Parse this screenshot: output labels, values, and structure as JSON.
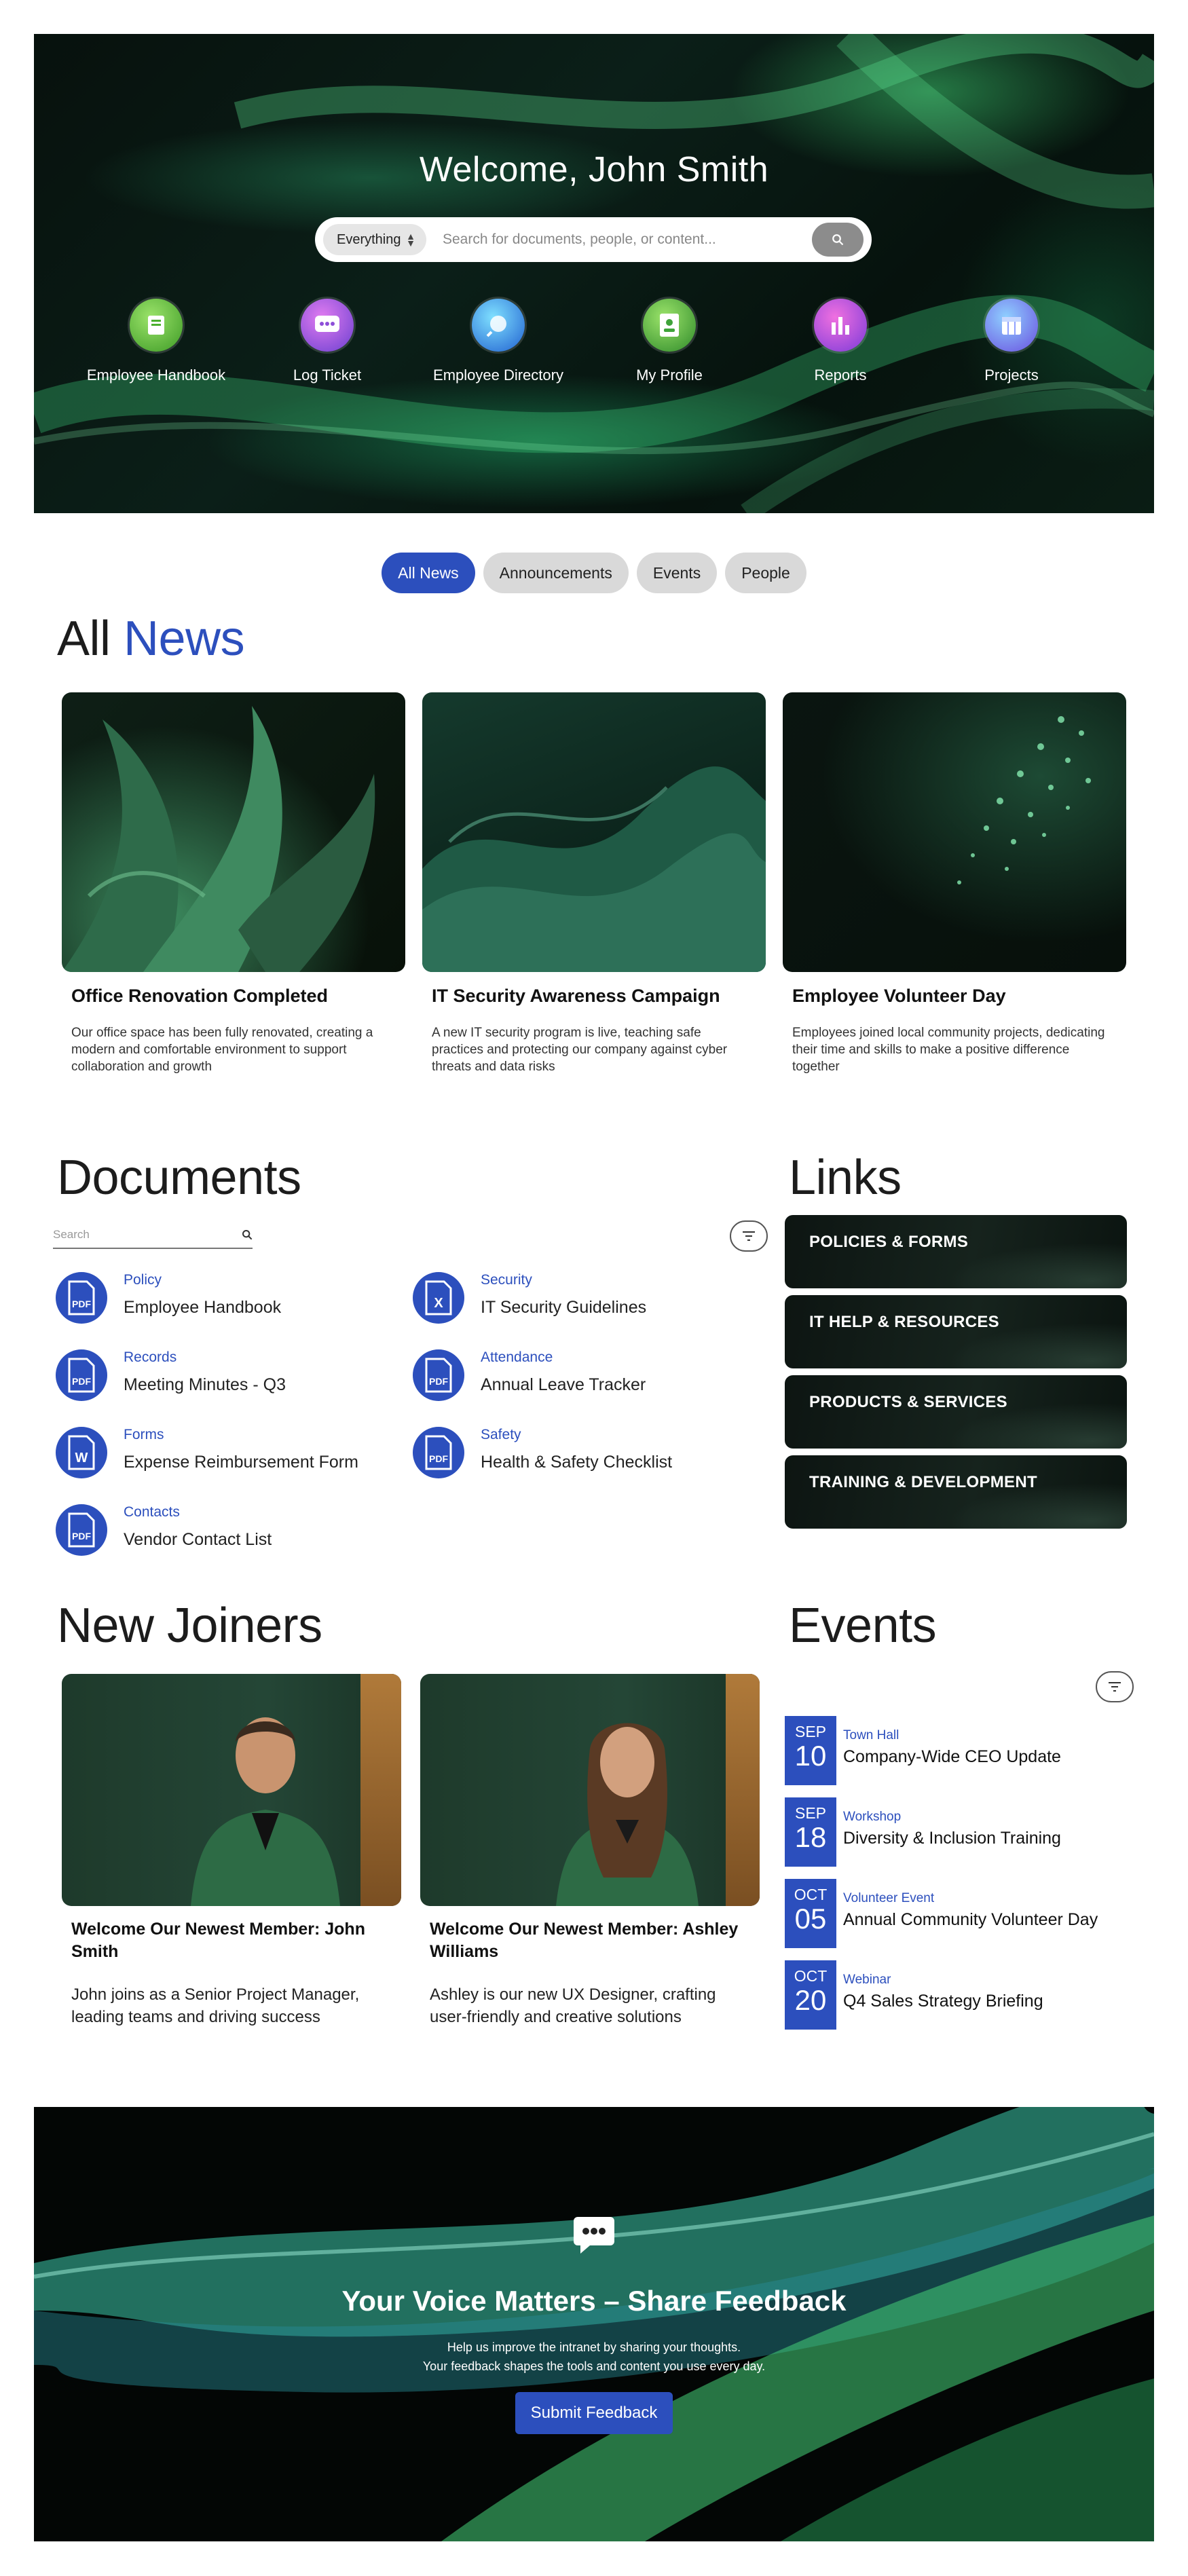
{
  "hero": {
    "welcome_prefix": "Welcome,",
    "user_name": "John Smith",
    "search_scope": "Everything",
    "search_placeholder": "Search for documents, people, or content...",
    "quick_links": [
      {
        "label": "Employee Handbook",
        "icon": "handbook-icon",
        "color": "#4caf2e"
      },
      {
        "label": "Log Ticket",
        "icon": "ticket-icon",
        "color": "#8e4fd8"
      },
      {
        "label": "Employee Directory",
        "icon": "directory-icon",
        "color": "#2f8fd8"
      },
      {
        "label": "My Profile",
        "icon": "profile-icon",
        "color": "#3fa33a"
      },
      {
        "label": "Reports",
        "icon": "reports-icon",
        "color": "#a044d8"
      },
      {
        "label": "Projects",
        "icon": "projects-icon",
        "color": "#6a5fe0"
      }
    ]
  },
  "tabs": [
    "All News",
    "Announcements",
    "Events",
    "People"
  ],
  "news": {
    "title_prefix": "All",
    "title_accent": "News",
    "items": [
      {
        "title": "Office Renovation Completed",
        "desc": "Our office space has been fully renovated, creating a modern and comfortable environment to support collaboration and growth"
      },
      {
        "title": "IT Security Awareness Campaign",
        "desc": "A new IT security program is live, teaching safe practices and protecting our company against cyber threats and data risks"
      },
      {
        "title": "Employee Volunteer Day",
        "desc": "Employees joined local community projects, dedicating their time and skills to make a positive difference together"
      }
    ]
  },
  "documents": {
    "title": "Documents",
    "search_placeholder": "Search",
    "items": [
      {
        "category": "Policy",
        "name": "Employee Handbook",
        "type": "PDF"
      },
      {
        "category": "Security",
        "name": "IT Security Guidelines",
        "type": "X"
      },
      {
        "category": "Records",
        "name": "Meeting Minutes - Q3",
        "type": "PDF"
      },
      {
        "category": "Attendance",
        "name": "Annual Leave Tracker",
        "type": "PDF"
      },
      {
        "category": "Forms",
        "name": "Expense Reimbursement Form",
        "type": "W"
      },
      {
        "category": "Safety",
        "name": "Health & Safety Checklist",
        "type": "PDF"
      },
      {
        "category": "Contacts",
        "name": "Vendor Contact List",
        "type": "PDF"
      }
    ]
  },
  "links": {
    "title": "Links",
    "items": [
      "POLICIES & FORMS",
      "IT HELP & RESOURCES",
      "PRODUCTS & SERVICES",
      "TRAINING & DEVELOPMENT"
    ]
  },
  "joiners": {
    "title": "New Joiners",
    "items": [
      {
        "title": "Welcome Our Newest Member: John Smith",
        "desc": "John joins as a Senior Project Manager, leading teams and driving success"
      },
      {
        "title": "Welcome Our Newest Member: Ashley Williams",
        "desc": "Ashley is our new UX Designer, crafting user-friendly and creative solutions"
      }
    ]
  },
  "events": {
    "title": "Events",
    "items": [
      {
        "month": "SEP",
        "day": "10",
        "category": "Town Hall",
        "name": "Company-Wide CEO Update"
      },
      {
        "month": "SEP",
        "day": "18",
        "category": "Workshop",
        "name": "Diversity & Inclusion Training"
      },
      {
        "month": "OCT",
        "day": "05",
        "category": "Volunteer Event",
        "name": "Annual Community Volunteer Day"
      },
      {
        "month": "OCT",
        "day": "20",
        "category": "Webinar",
        "name": "Q4 Sales Strategy Briefing"
      }
    ]
  },
  "feedback": {
    "title": "Your Voice Matters – Share Feedback",
    "line1": "Help us improve the intranet by sharing your thoughts.",
    "line2": "Your feedback shapes the tools and content you use every day.",
    "button": "Submit Feedback"
  },
  "colors": {
    "accent": "#2c4fbd"
  }
}
